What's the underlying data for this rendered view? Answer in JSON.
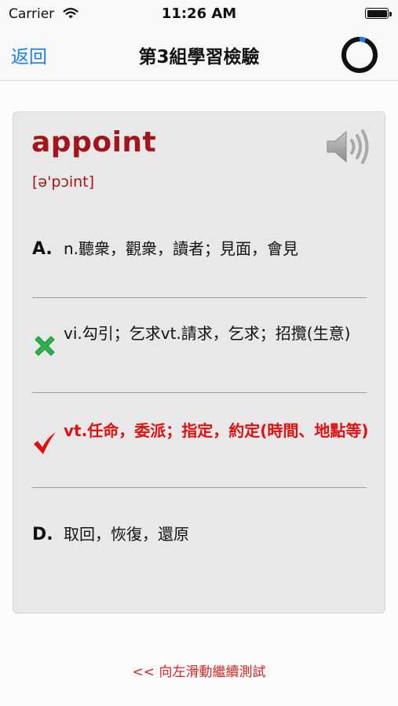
{
  "status_bar": {
    "carrier": "Carrier",
    "time": "11:26 AM"
  },
  "nav": {
    "back_label": "返回",
    "title": "第3組學習檢驗",
    "timer_progress": 0.06
  },
  "card": {
    "word": "appoint",
    "phonetic": "[ə'pɔint]",
    "speaker_icon": "speaker-icon",
    "options": [
      {
        "marker": "A.",
        "text": "n.聽衆，觀衆，讀者；見面，會見",
        "state": "normal"
      },
      {
        "marker": "",
        "marker_icon": "wrong-cross-icon",
        "text": "vi.勾引；乞求vt.請求，乞求；招攬(生意)",
        "state": "wrong"
      },
      {
        "marker": "",
        "marker_icon": "correct-check-icon",
        "text": "vt.任命，委派；指定，約定(時間、地點等)",
        "state": "correct"
      },
      {
        "marker": "D.",
        "text": "取回，恢復，還原",
        "state": "normal"
      }
    ]
  },
  "footer": {
    "swipe_hint": "<< 向左滑動繼續測試"
  },
  "colors": {
    "accent_blue": "#1a7ee6",
    "word_red": "#a0161a",
    "correct_red": "#e01010",
    "wrong_green": "#2bb34a",
    "hint_red": "#d42424"
  }
}
